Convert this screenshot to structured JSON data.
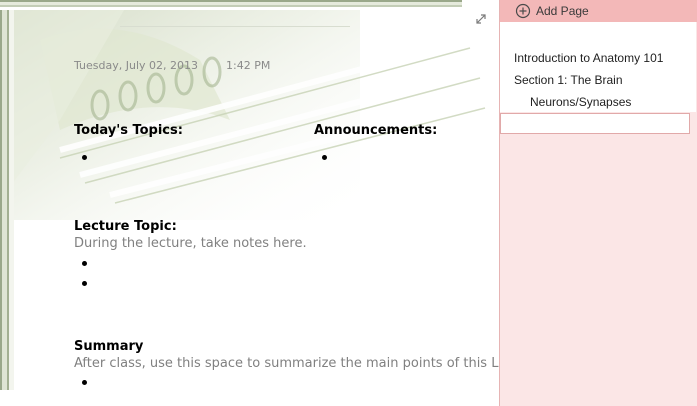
{
  "note": {
    "date": "Tuesday, July 02, 2013",
    "time": "1:42 PM",
    "todays_topics_title": "Today's Topics:",
    "announcements_title": "Announcements:",
    "lecture_topic_title": "Lecture Topic:",
    "lecture_topic_hint": "During the lecture, take notes here.",
    "summary_title": "Summary",
    "summary_hint": "After class, use this space to summarize the main points of this Lectu"
  },
  "pane": {
    "add_page_label": "Add Page",
    "pages": [
      "Introduction to Anatomy 101",
      "Section 1: The Brain",
      "Neurons/Synapses"
    ]
  },
  "icons": {
    "expand": "expand-icon",
    "add": "add-circle-icon"
  },
  "colors": {
    "pane_background": "#fbe6e6",
    "add_page_bar": "#f3b8b8",
    "hint_text": "#808080"
  }
}
